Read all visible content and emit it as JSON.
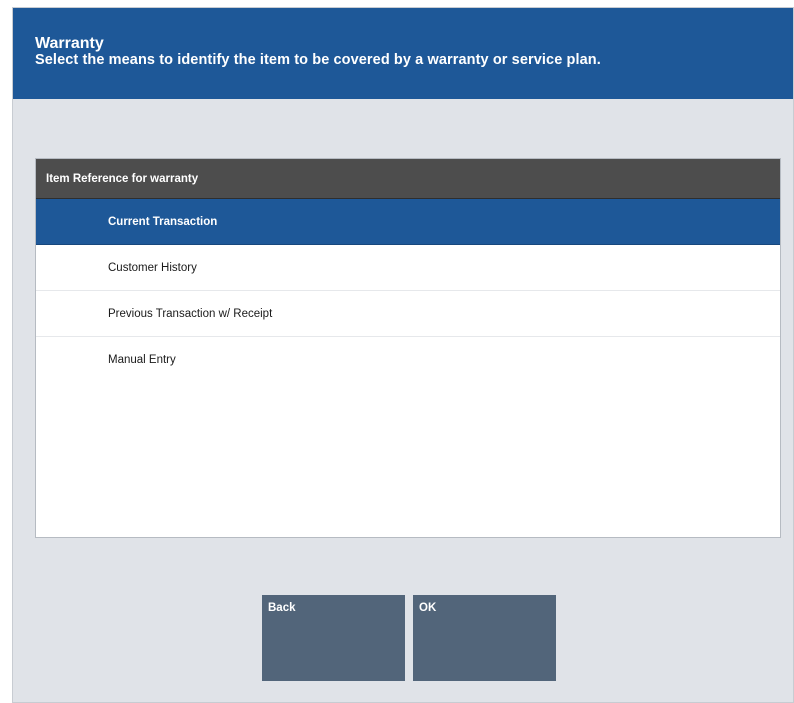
{
  "header": {
    "title": "Warranty",
    "subtitle": "Select the means to identify the item to be covered by a warranty or service plan."
  },
  "list": {
    "heading": "Item Reference for warranty",
    "items": [
      {
        "label": "Current Transaction",
        "selected": true
      },
      {
        "label": "Customer History",
        "selected": false
      },
      {
        "label": "Previous Transaction w/ Receipt",
        "selected": false
      },
      {
        "label": "Manual Entry",
        "selected": false
      }
    ]
  },
  "buttons": {
    "back_label": "Back",
    "ok_label": "OK"
  },
  "colors": {
    "header_bg": "#1e5898",
    "selected_bg": "#1e5898",
    "list_header_bg": "#4d4d4d",
    "button_bg": "#52657a",
    "frame_bg": "#e0e3e8"
  }
}
